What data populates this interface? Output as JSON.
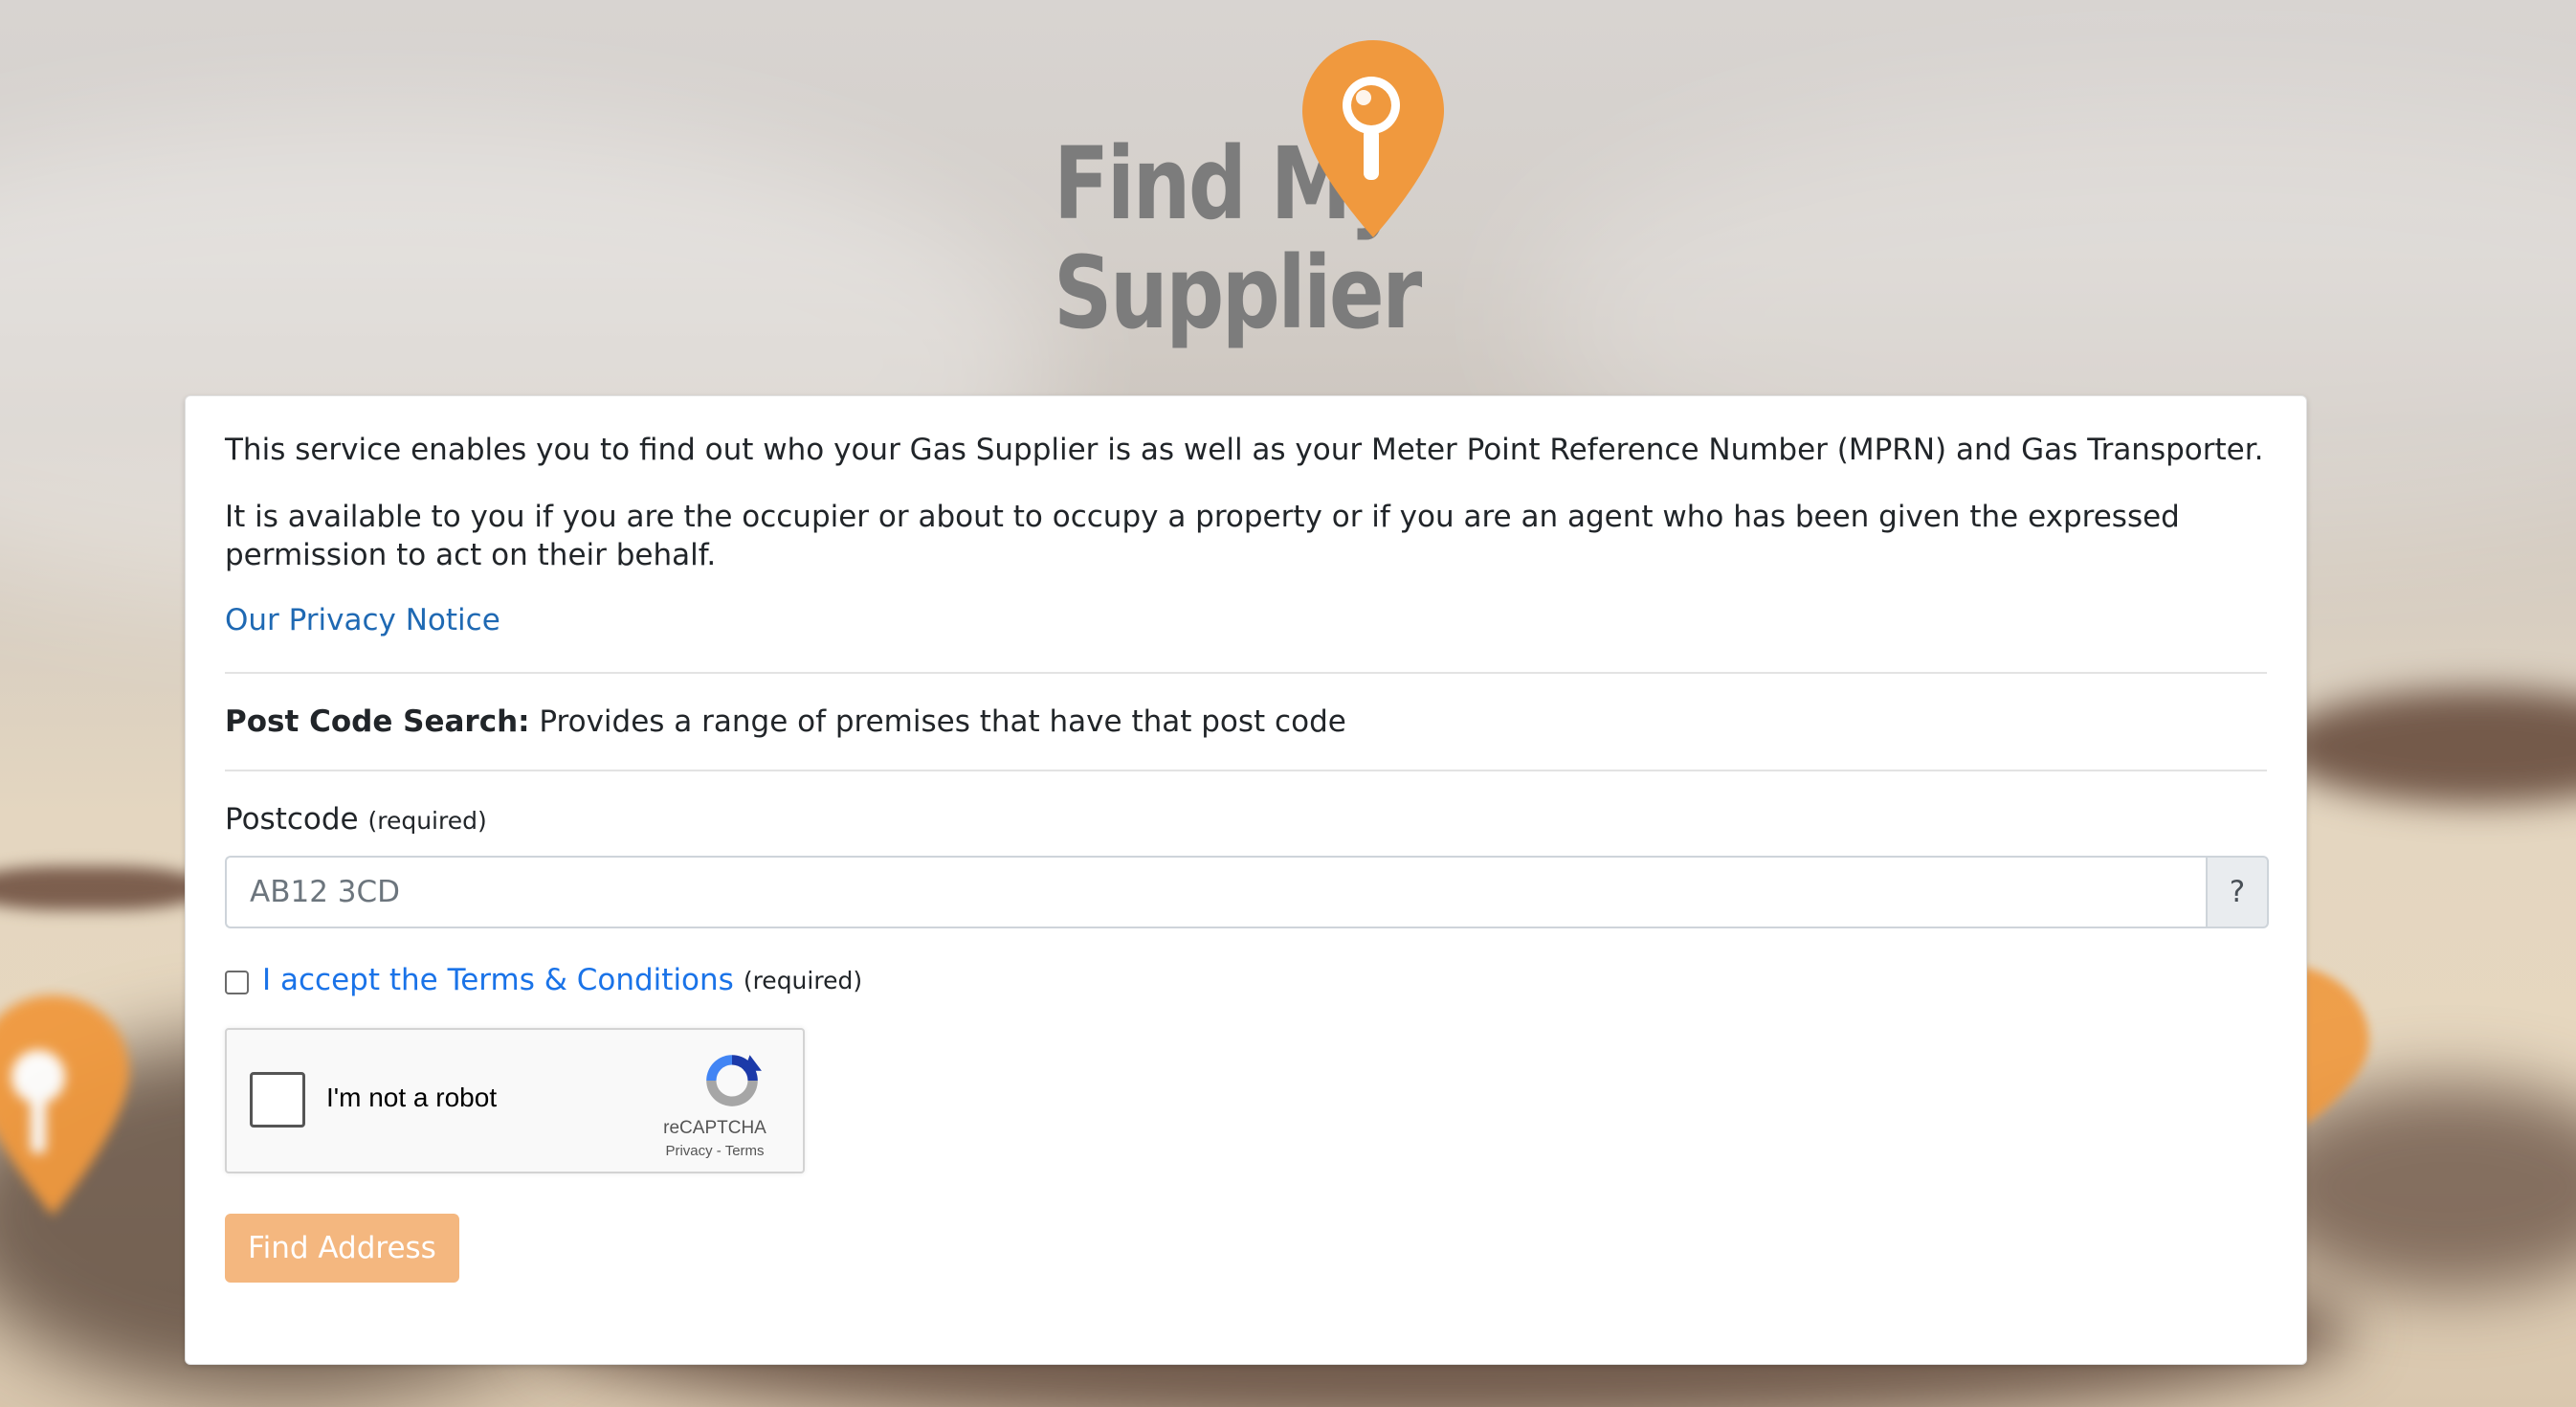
{
  "logo": {
    "line1": "Find My",
    "line2": "Supplier",
    "icon": "orange-map-pin-with-magnifier"
  },
  "intro": {
    "paragraph1": "This service enables you to find out who your Gas Supplier is as well as your Meter Point Reference Number (MPRN) and Gas Transporter.",
    "paragraph2": "It is available to you if you are the occupier or about to occupy a property or if you are an agent who has been given the expressed permission to act on their behalf.",
    "privacy_link": "Our Privacy Notice"
  },
  "search": {
    "heading": "Post Code Search:",
    "description": " Provides a range of premises that have that post code"
  },
  "postcode": {
    "label": "Postcode",
    "required": "(required)",
    "placeholder": "AB12 3CD",
    "value": "",
    "help": "?"
  },
  "terms": {
    "link": "I accept the Terms & Conditions",
    "required": "(required)",
    "checked": false
  },
  "recaptcha": {
    "label": "I'm not a robot",
    "brand": "reCAPTCHA",
    "privacy": "Privacy",
    "separator": " - ",
    "terms": "Terms"
  },
  "actions": {
    "find_button": "Find Address"
  },
  "colors": {
    "brand_orange": "#f0993e",
    "button_disabled": "#f4b77f",
    "link_blue": "#1f69b3",
    "logo_grey": "#7c7c7c"
  }
}
